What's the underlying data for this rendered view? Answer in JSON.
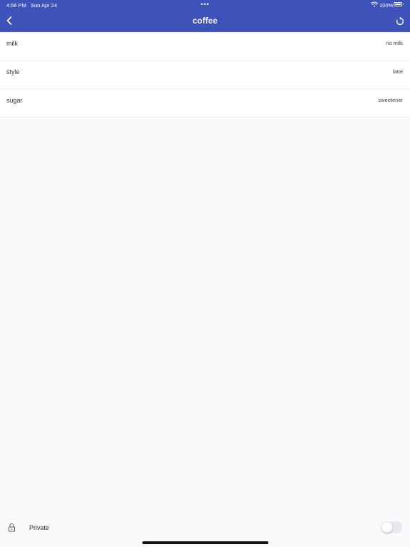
{
  "status_bar": {
    "time": "4:56 PM",
    "date": "Sun Apr 24",
    "dots": "•••",
    "battery": "100%"
  },
  "header": {
    "title": "coffee",
    "back_icon": "chevron-left-icon",
    "refresh_icon": "refresh-icon"
  },
  "options": [
    {
      "label": "milk",
      "value": "no milk"
    },
    {
      "label": "style",
      "value": "latte"
    },
    {
      "label": "sugar",
      "value": "sweetener"
    }
  ],
  "footer": {
    "private_label": "Private",
    "private_enabled": false,
    "lock_icon": "lock-icon"
  },
  "colors": {
    "header_background": "#3d53b9",
    "page_background": "#faf9fb",
    "toggle_off": "#e9e8ec"
  }
}
